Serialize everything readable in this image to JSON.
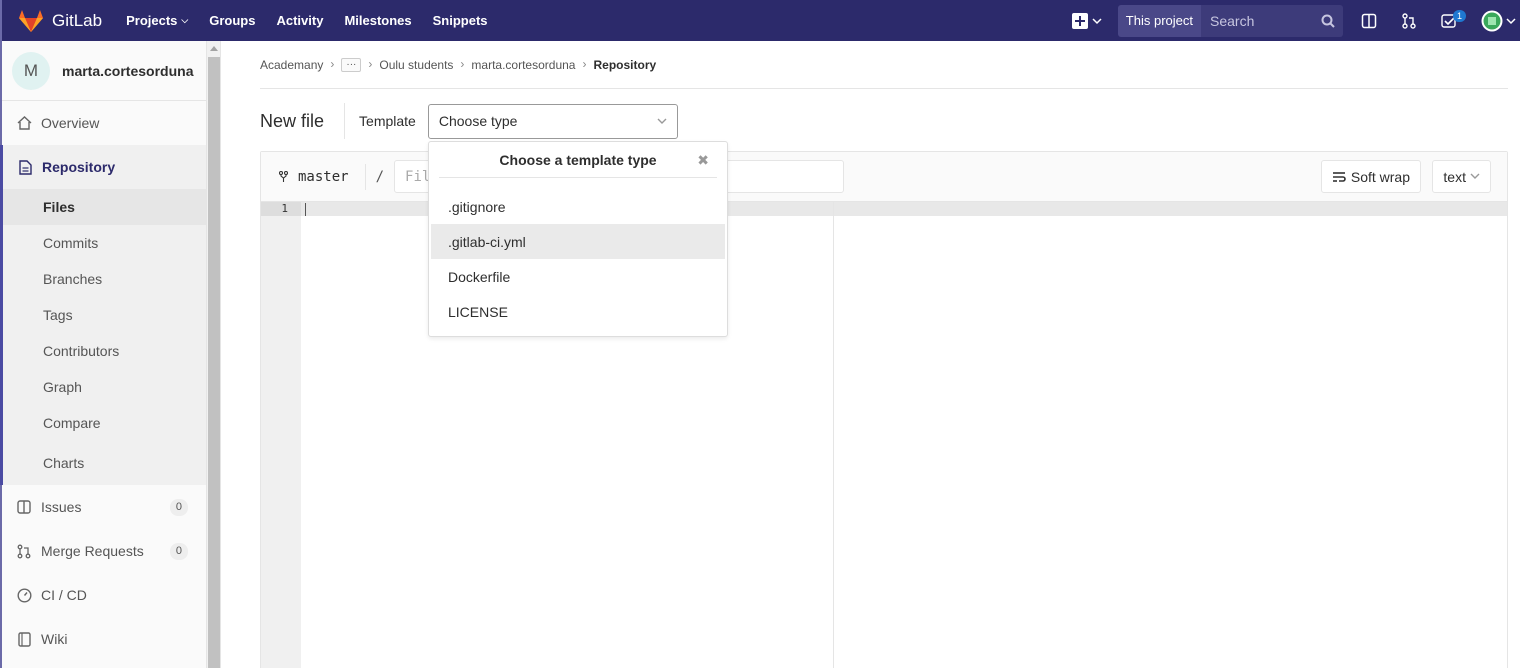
{
  "app": {
    "name": "GitLab"
  },
  "nav": {
    "links": [
      {
        "label": "Projects",
        "has_caret": true
      },
      {
        "label": "Groups",
        "has_caret": false
      },
      {
        "label": "Activity",
        "has_caret": false
      },
      {
        "label": "Milestones",
        "has_caret": false
      },
      {
        "label": "Snippets",
        "has_caret": false
      }
    ],
    "search_scope": "This project",
    "search_placeholder": "Search",
    "todo_count": "1"
  },
  "sidebar": {
    "project_initial": "M",
    "project_name": "marta.cortesorduna",
    "overview": "Overview",
    "repository": "Repository",
    "repo_items": [
      "Files",
      "Commits",
      "Branches",
      "Tags",
      "Contributors",
      "Graph",
      "Compare",
      "Charts"
    ],
    "issues": "Issues",
    "issues_count": "0",
    "merge_requests": "Merge Requests",
    "mr_count": "0",
    "cicd": "CI / CD",
    "wiki": "Wiki"
  },
  "breadcrumb": {
    "items": [
      "Academany",
      "Oulu students",
      "marta.cortesorduna",
      "Repository"
    ],
    "ellipsis": "···"
  },
  "page": {
    "title": "New file",
    "template_label": "Template",
    "template_select": "Choose type"
  },
  "editor": {
    "branch": "master",
    "slash": "/",
    "filename_placeholder": "Fil",
    "soft_wrap": "Soft wrap",
    "mode": "text",
    "line_number": "1"
  },
  "dropdown": {
    "title": "Choose a template type",
    "close": "✖",
    "items": [
      ".gitignore",
      ".gitlab-ci.yml",
      "Dockerfile",
      "LICENSE"
    ]
  },
  "colors": {
    "navbar": "#2c2a6b",
    "accent": "#4b4ba3",
    "badge": "#1f78d1"
  }
}
